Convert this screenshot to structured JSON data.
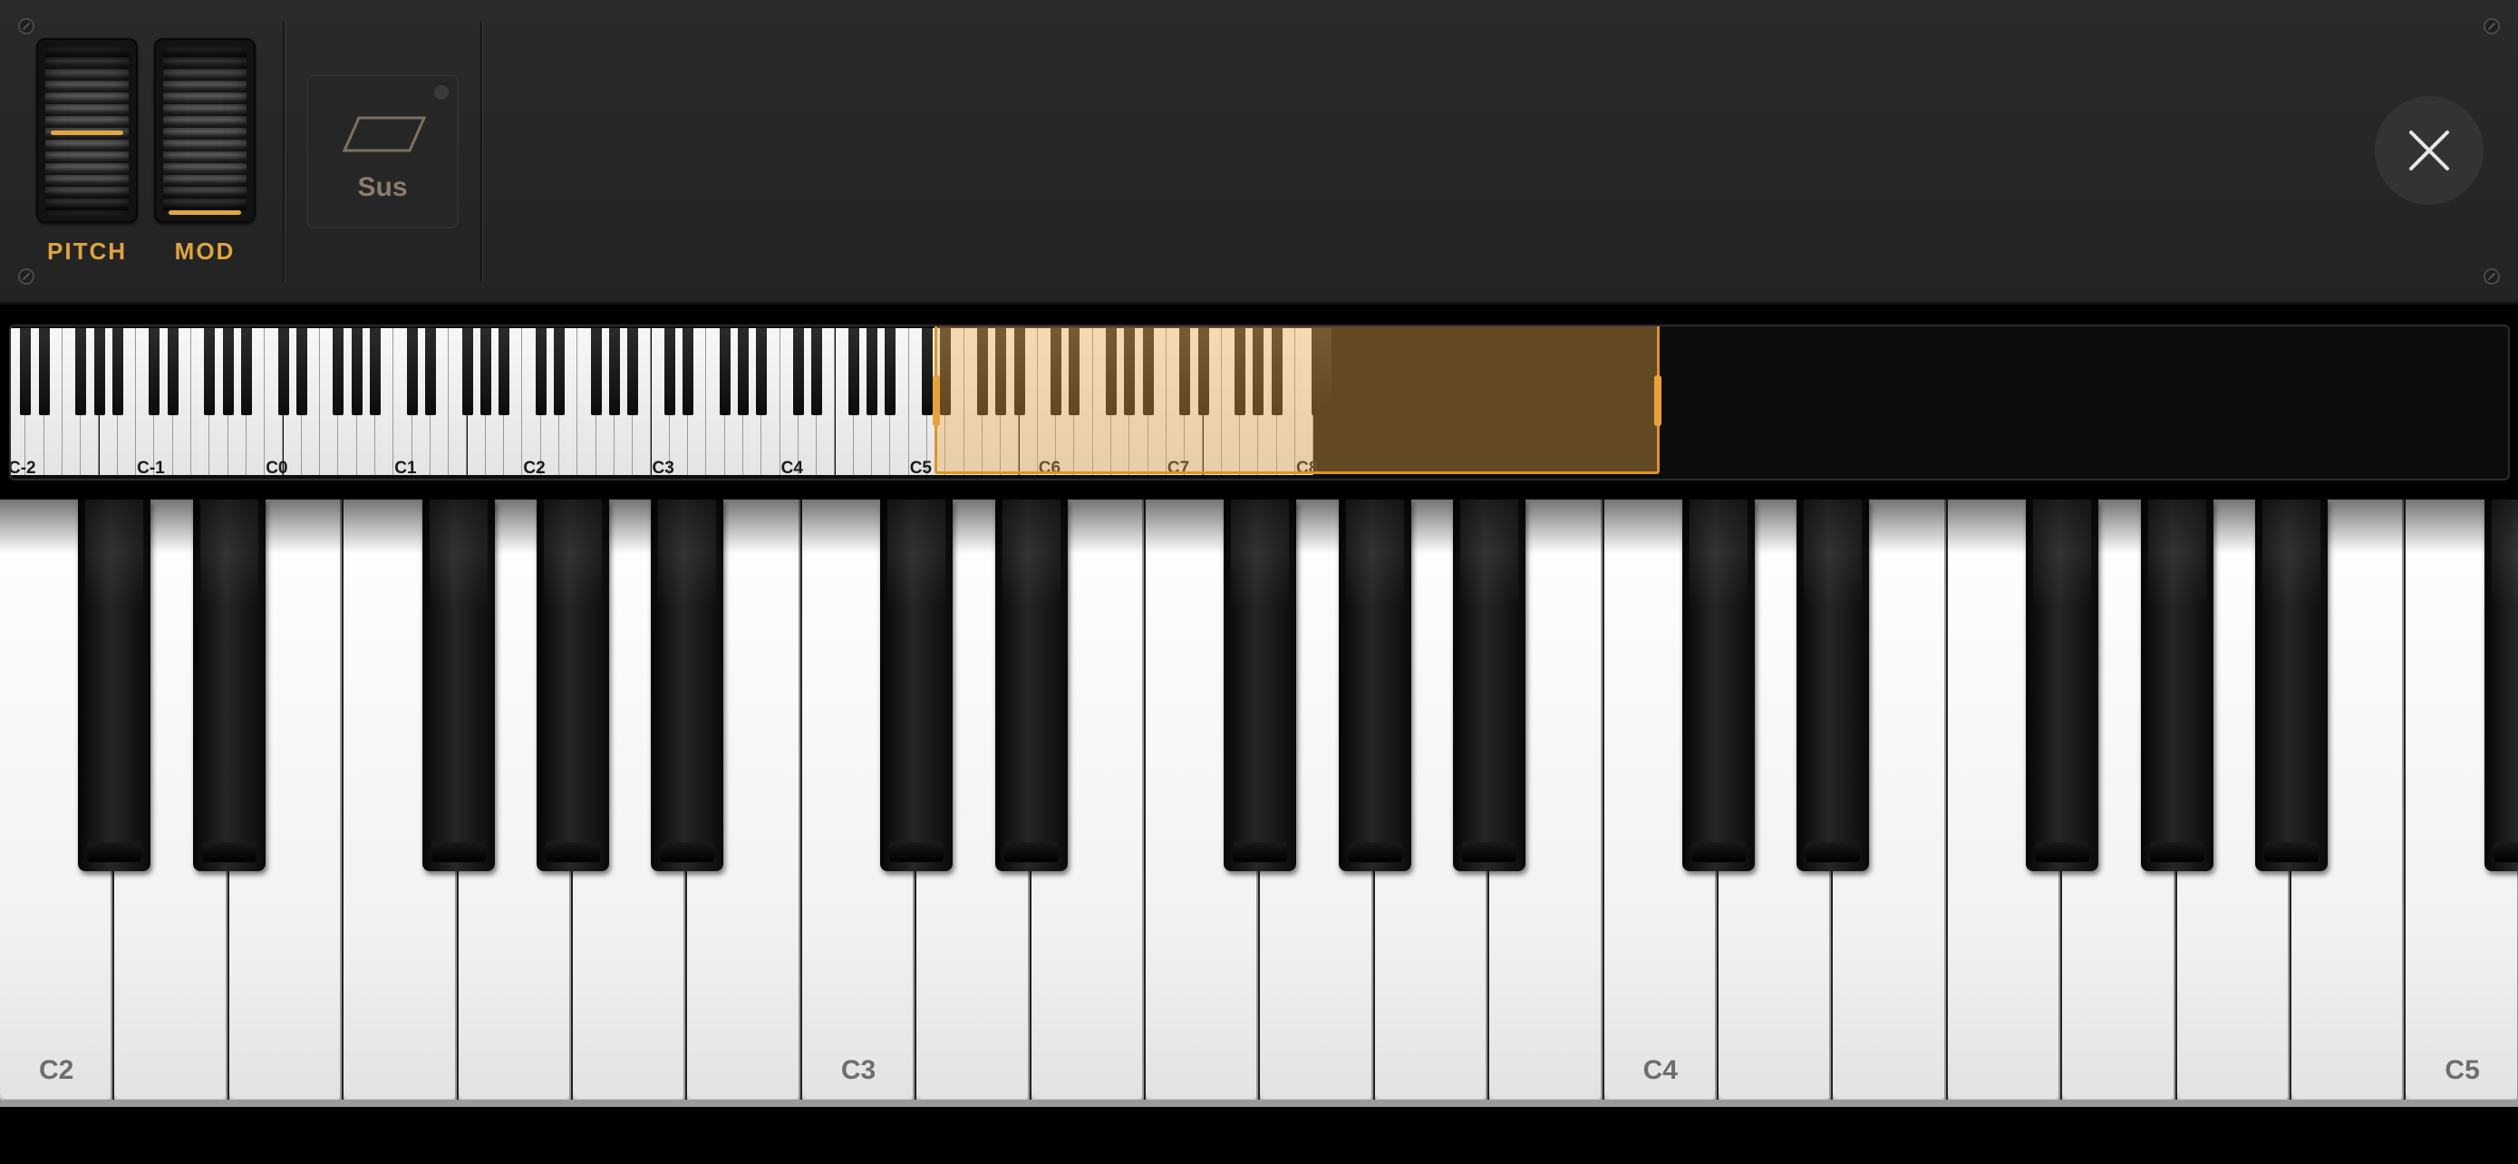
{
  "controls": {
    "pitch_label": "PITCH",
    "mod_label": "MOD",
    "pitch_wheel_level": 0.5,
    "mod_wheel_level": 0.0,
    "sustain_label": "Sus",
    "sustain_on": false,
    "close_icon": "close-icon",
    "accent_color": "#e0a43c"
  },
  "mini_keyboard": {
    "octave_labels": [
      "C-2",
      "C-1",
      "C0",
      "C1",
      "C2",
      "C3",
      "C4",
      "C5",
      "C6",
      "C7",
      "C8"
    ],
    "selected_range": {
      "start": "C2",
      "end": "C5"
    }
  },
  "keyboard": {
    "octaves": [
      2,
      3,
      4,
      5
    ],
    "c_labels": [
      "C2",
      "C3",
      "C4",
      "C5"
    ]
  }
}
